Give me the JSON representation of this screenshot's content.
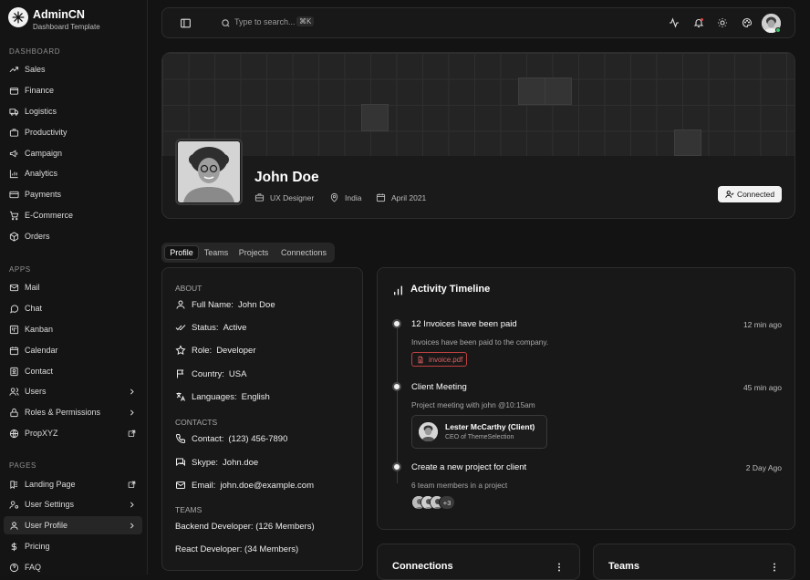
{
  "brand": {
    "name": "AdminCN",
    "subtitle": "Dashboard Template"
  },
  "sidebar": {
    "sections": [
      {
        "title": "DASHBOARD",
        "items": [
          {
            "label": "Sales",
            "icon": "trending-up-icon"
          },
          {
            "label": "Finance",
            "icon": "wallet-icon"
          },
          {
            "label": "Logistics",
            "icon": "truck-icon"
          },
          {
            "label": "Productivity",
            "icon": "briefcase-icon"
          },
          {
            "label": "Campaign",
            "icon": "megaphone-icon"
          },
          {
            "label": "Analytics",
            "icon": "bar-chart-icon"
          },
          {
            "label": "Payments",
            "icon": "credit-card-icon"
          },
          {
            "label": "E-Commerce",
            "icon": "cart-icon"
          },
          {
            "label": "Orders",
            "icon": "package-icon"
          }
        ]
      },
      {
        "title": "APPS",
        "items": [
          {
            "label": "Mail",
            "icon": "mail-icon"
          },
          {
            "label": "Chat",
            "icon": "chat-icon"
          },
          {
            "label": "Kanban",
            "icon": "kanban-icon"
          },
          {
            "label": "Calendar",
            "icon": "calendar-icon"
          },
          {
            "label": "Contact",
            "icon": "contact-icon"
          },
          {
            "label": "Users",
            "icon": "users-icon",
            "trailing": "chevron-right-icon"
          },
          {
            "label": "Roles & Permissions",
            "icon": "lock-icon",
            "trailing": "chevron-right-icon"
          },
          {
            "label": "PropXYZ",
            "icon": "globe-icon",
            "trailing": "external-link-icon"
          }
        ]
      },
      {
        "title": "PAGES",
        "items": [
          {
            "label": "Landing Page",
            "icon": "landing-icon",
            "trailing": "external-link-icon"
          },
          {
            "label": "User Settings",
            "icon": "user-cog-icon",
            "trailing": "chevron-right-icon"
          },
          {
            "label": "User Profile",
            "icon": "user-icon",
            "trailing": "chevron-right-icon",
            "active": true
          },
          {
            "label": "Pricing",
            "icon": "dollar-icon"
          },
          {
            "label": "FAQ",
            "icon": "help-icon"
          }
        ]
      }
    ]
  },
  "topbar": {
    "search_placeholder": "Type to search...",
    "search_shortcut": "⌘K",
    "icons": [
      "sidebar-toggle-icon",
      "search-icon",
      "activity-icon",
      "bell-icon",
      "sun-icon",
      "palette-icon",
      "avatar"
    ]
  },
  "profile": {
    "name": "John Doe",
    "meta": [
      {
        "icon": "briefcase-icon",
        "text": "UX Designer"
      },
      {
        "icon": "map-pin-icon",
        "text": "India"
      },
      {
        "icon": "calendar-icon",
        "text": "April 2021"
      }
    ],
    "connected_label": "Connected"
  },
  "tabs": [
    "Profile",
    "Teams",
    "Projects",
    "Connections"
  ],
  "about": {
    "about_label": "ABOUT",
    "about_rows": [
      {
        "icon": "user-icon",
        "key": "Full Name:",
        "value": "John Doe"
      },
      {
        "icon": "check-double-icon",
        "key": "Status:",
        "value": "Active"
      },
      {
        "icon": "star-icon",
        "key": "Role:",
        "value": "Developer"
      },
      {
        "icon": "flag-icon",
        "key": "Country:",
        "value": "USA"
      },
      {
        "icon": "languages-icon",
        "key": "Languages:",
        "value": "English"
      }
    ],
    "contacts_label": "CONTACTS",
    "contact_rows": [
      {
        "icon": "phone-icon",
        "key": "Contact:",
        "value": "(123) 456-7890"
      },
      {
        "icon": "message-icon",
        "key": "Skype:",
        "value": "John.doe"
      },
      {
        "icon": "mail-icon",
        "key": "Email:",
        "value": "john.doe@example.com"
      }
    ],
    "teams_label": "TEAMS",
    "team_rows": [
      {
        "name": "Backend Developer:",
        "count": "(126 Members)"
      },
      {
        "name": "React Developer:",
        "count": "(34 Members)"
      }
    ]
  },
  "activity": {
    "title": "Activity Timeline",
    "events": [
      {
        "title": "12 Invoices have been paid",
        "time": "12 min ago",
        "desc": "Invoices have been paid to the company.",
        "attachment": "invoice.pdf"
      },
      {
        "title": "Client Meeting",
        "time": "45 min ago",
        "desc": "Project meeting with john @10:15am",
        "person": {
          "name": "Lester McCarthy (Client)",
          "role": "CEO of ThemeSelection"
        }
      },
      {
        "title": "Create a new project for client",
        "time": "2 Day Ago",
        "desc": "6 team members in a project",
        "more_members": "+3"
      }
    ]
  },
  "bottom_cards": {
    "connections_title": "Connections",
    "teams_title": "Teams"
  },
  "colors": {
    "background": "#131313",
    "panel": "#181818",
    "border": "#2d2d2d",
    "accent_red": "#e06161",
    "online_green": "#3cc36a"
  }
}
